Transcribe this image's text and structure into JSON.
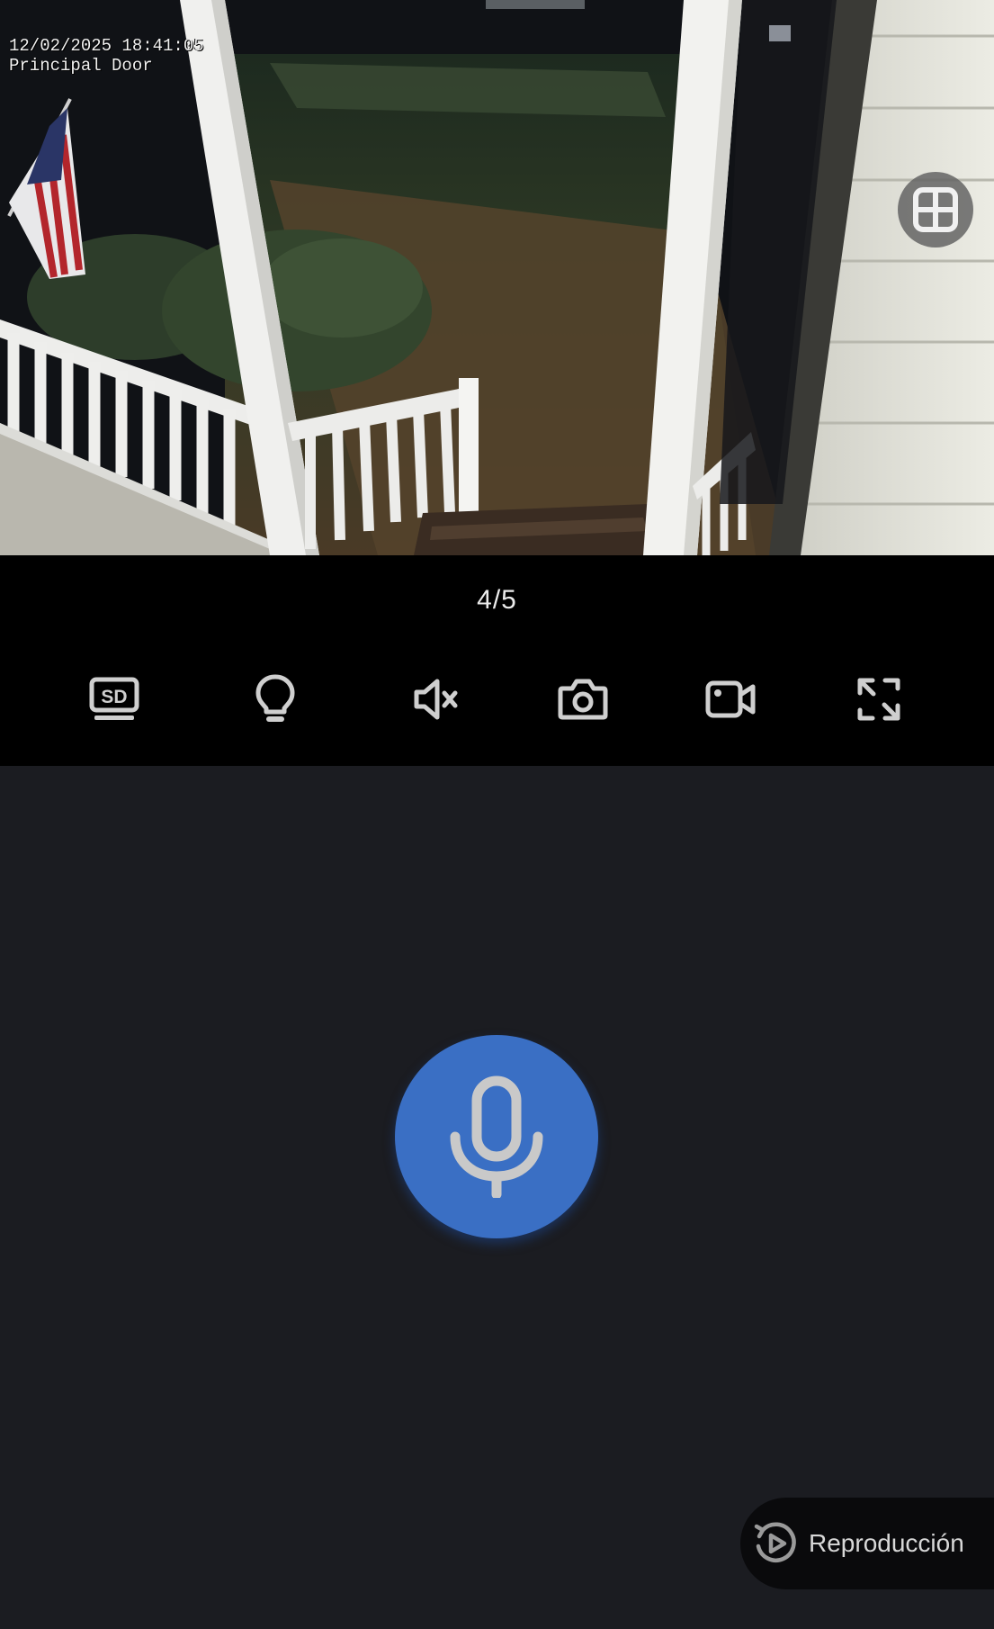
{
  "camera": {
    "timestamp": "12/02/2025 18:41:05",
    "name": "Principal Door"
  },
  "page_indicator": "4/5",
  "toolbar": {
    "items": [
      {
        "icon": "sd-quality-icon"
      },
      {
        "icon": "light-bulb-icon"
      },
      {
        "icon": "speaker-muted-icon"
      },
      {
        "icon": "camera-snapshot-icon"
      },
      {
        "icon": "video-record-icon"
      },
      {
        "icon": "fullscreen-icon"
      }
    ],
    "sd_label": "SD"
  },
  "talk": {
    "icon": "microphone-icon",
    "color": "#3a6fc4"
  },
  "playback": {
    "label": "Reproducción",
    "icon": "replay-icon"
  },
  "colors": {
    "background": "#1b1c21",
    "toolbar": "#000000",
    "accent": "#3a6fc4",
    "icon": "#cfcfcf"
  }
}
